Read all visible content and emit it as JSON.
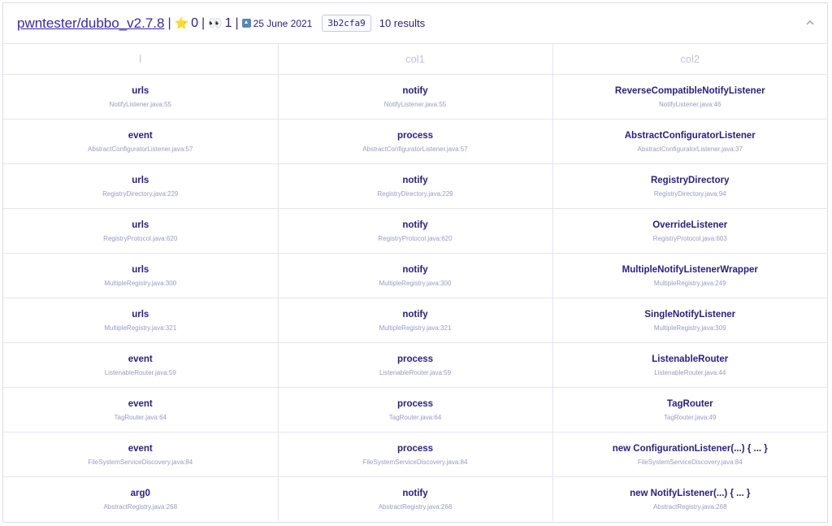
{
  "header": {
    "repo": "pwntester/dubbo_v2.7.8",
    "sep": "|",
    "stars": "0",
    "star_icon": "star-icon",
    "watchers": "1",
    "eyes_icon": "eyes-icon",
    "date": "25 June 2021",
    "push_icon": "push-icon",
    "commit": "3b2cfa9",
    "result_count": "10 results"
  },
  "table": {
    "columns": [
      "l",
      "col1",
      "col2"
    ],
    "rows": [
      {
        "c0": {
          "name": "urls",
          "loc": "NotifyListener.java:55"
        },
        "c1": {
          "name": "notify",
          "loc": "NotifyListener.java:55"
        },
        "c2": {
          "name": "ReverseCompatibleNotifyListener",
          "loc": "NotifyListener.java:46"
        }
      },
      {
        "c0": {
          "name": "event",
          "loc": "AbstractConfiguratorListener.java:57"
        },
        "c1": {
          "name": "process",
          "loc": "AbstractConfiguratorListener.java:57"
        },
        "c2": {
          "name": "AbstractConfiguratorListener",
          "loc": "AbstractConfiguratorListener.java:37"
        }
      },
      {
        "c0": {
          "name": "urls",
          "loc": "RegistryDirectory.java:229"
        },
        "c1": {
          "name": "notify",
          "loc": "RegistryDirectory.java:229"
        },
        "c2": {
          "name": "RegistryDirectory",
          "loc": "RegistryDirectory.java:94"
        }
      },
      {
        "c0": {
          "name": "urls",
          "loc": "RegistryProtocol.java:620"
        },
        "c1": {
          "name": "notify",
          "loc": "RegistryProtocol.java:620"
        },
        "c2": {
          "name": "OverrideListener",
          "loc": "RegistryProtocol.java:603"
        }
      },
      {
        "c0": {
          "name": "urls",
          "loc": "MultipleRegistry.java:300"
        },
        "c1": {
          "name": "notify",
          "loc": "MultipleRegistry.java:300"
        },
        "c2": {
          "name": "MultipleNotifyListenerWrapper",
          "loc": "MultipleRegistry.java:249"
        }
      },
      {
        "c0": {
          "name": "urls",
          "loc": "MultipleRegistry.java:321"
        },
        "c1": {
          "name": "notify",
          "loc": "MultipleRegistry.java:321"
        },
        "c2": {
          "name": "SingleNotifyListener",
          "loc": "MultipleRegistry.java:309"
        }
      },
      {
        "c0": {
          "name": "event",
          "loc": "ListenableRouter.java:59"
        },
        "c1": {
          "name": "process",
          "loc": "ListenableRouter.java:59"
        },
        "c2": {
          "name": "ListenableRouter",
          "loc": "ListenableRouter.java:44"
        }
      },
      {
        "c0": {
          "name": "event",
          "loc": "TagRouter.java:64"
        },
        "c1": {
          "name": "process",
          "loc": "TagRouter.java:64"
        },
        "c2": {
          "name": "TagRouter",
          "loc": "TagRouter.java:49"
        }
      },
      {
        "c0": {
          "name": "event",
          "loc": "FileSystemServiceDiscovery.java:84"
        },
        "c1": {
          "name": "process",
          "loc": "FileSystemServiceDiscovery.java:84"
        },
        "c2": {
          "name": "new ConfigurationListener(...) { ... }",
          "loc": "FileSystemServiceDiscovery.java:84"
        }
      },
      {
        "c0": {
          "name": "arg0",
          "loc": "AbstractRegistry.java:268"
        },
        "c1": {
          "name": "notify",
          "loc": "AbstractRegistry.java:268"
        },
        "c2": {
          "name": "new NotifyListener(...) { ... }",
          "loc": "AbstractRegistry.java:268"
        }
      }
    ]
  }
}
